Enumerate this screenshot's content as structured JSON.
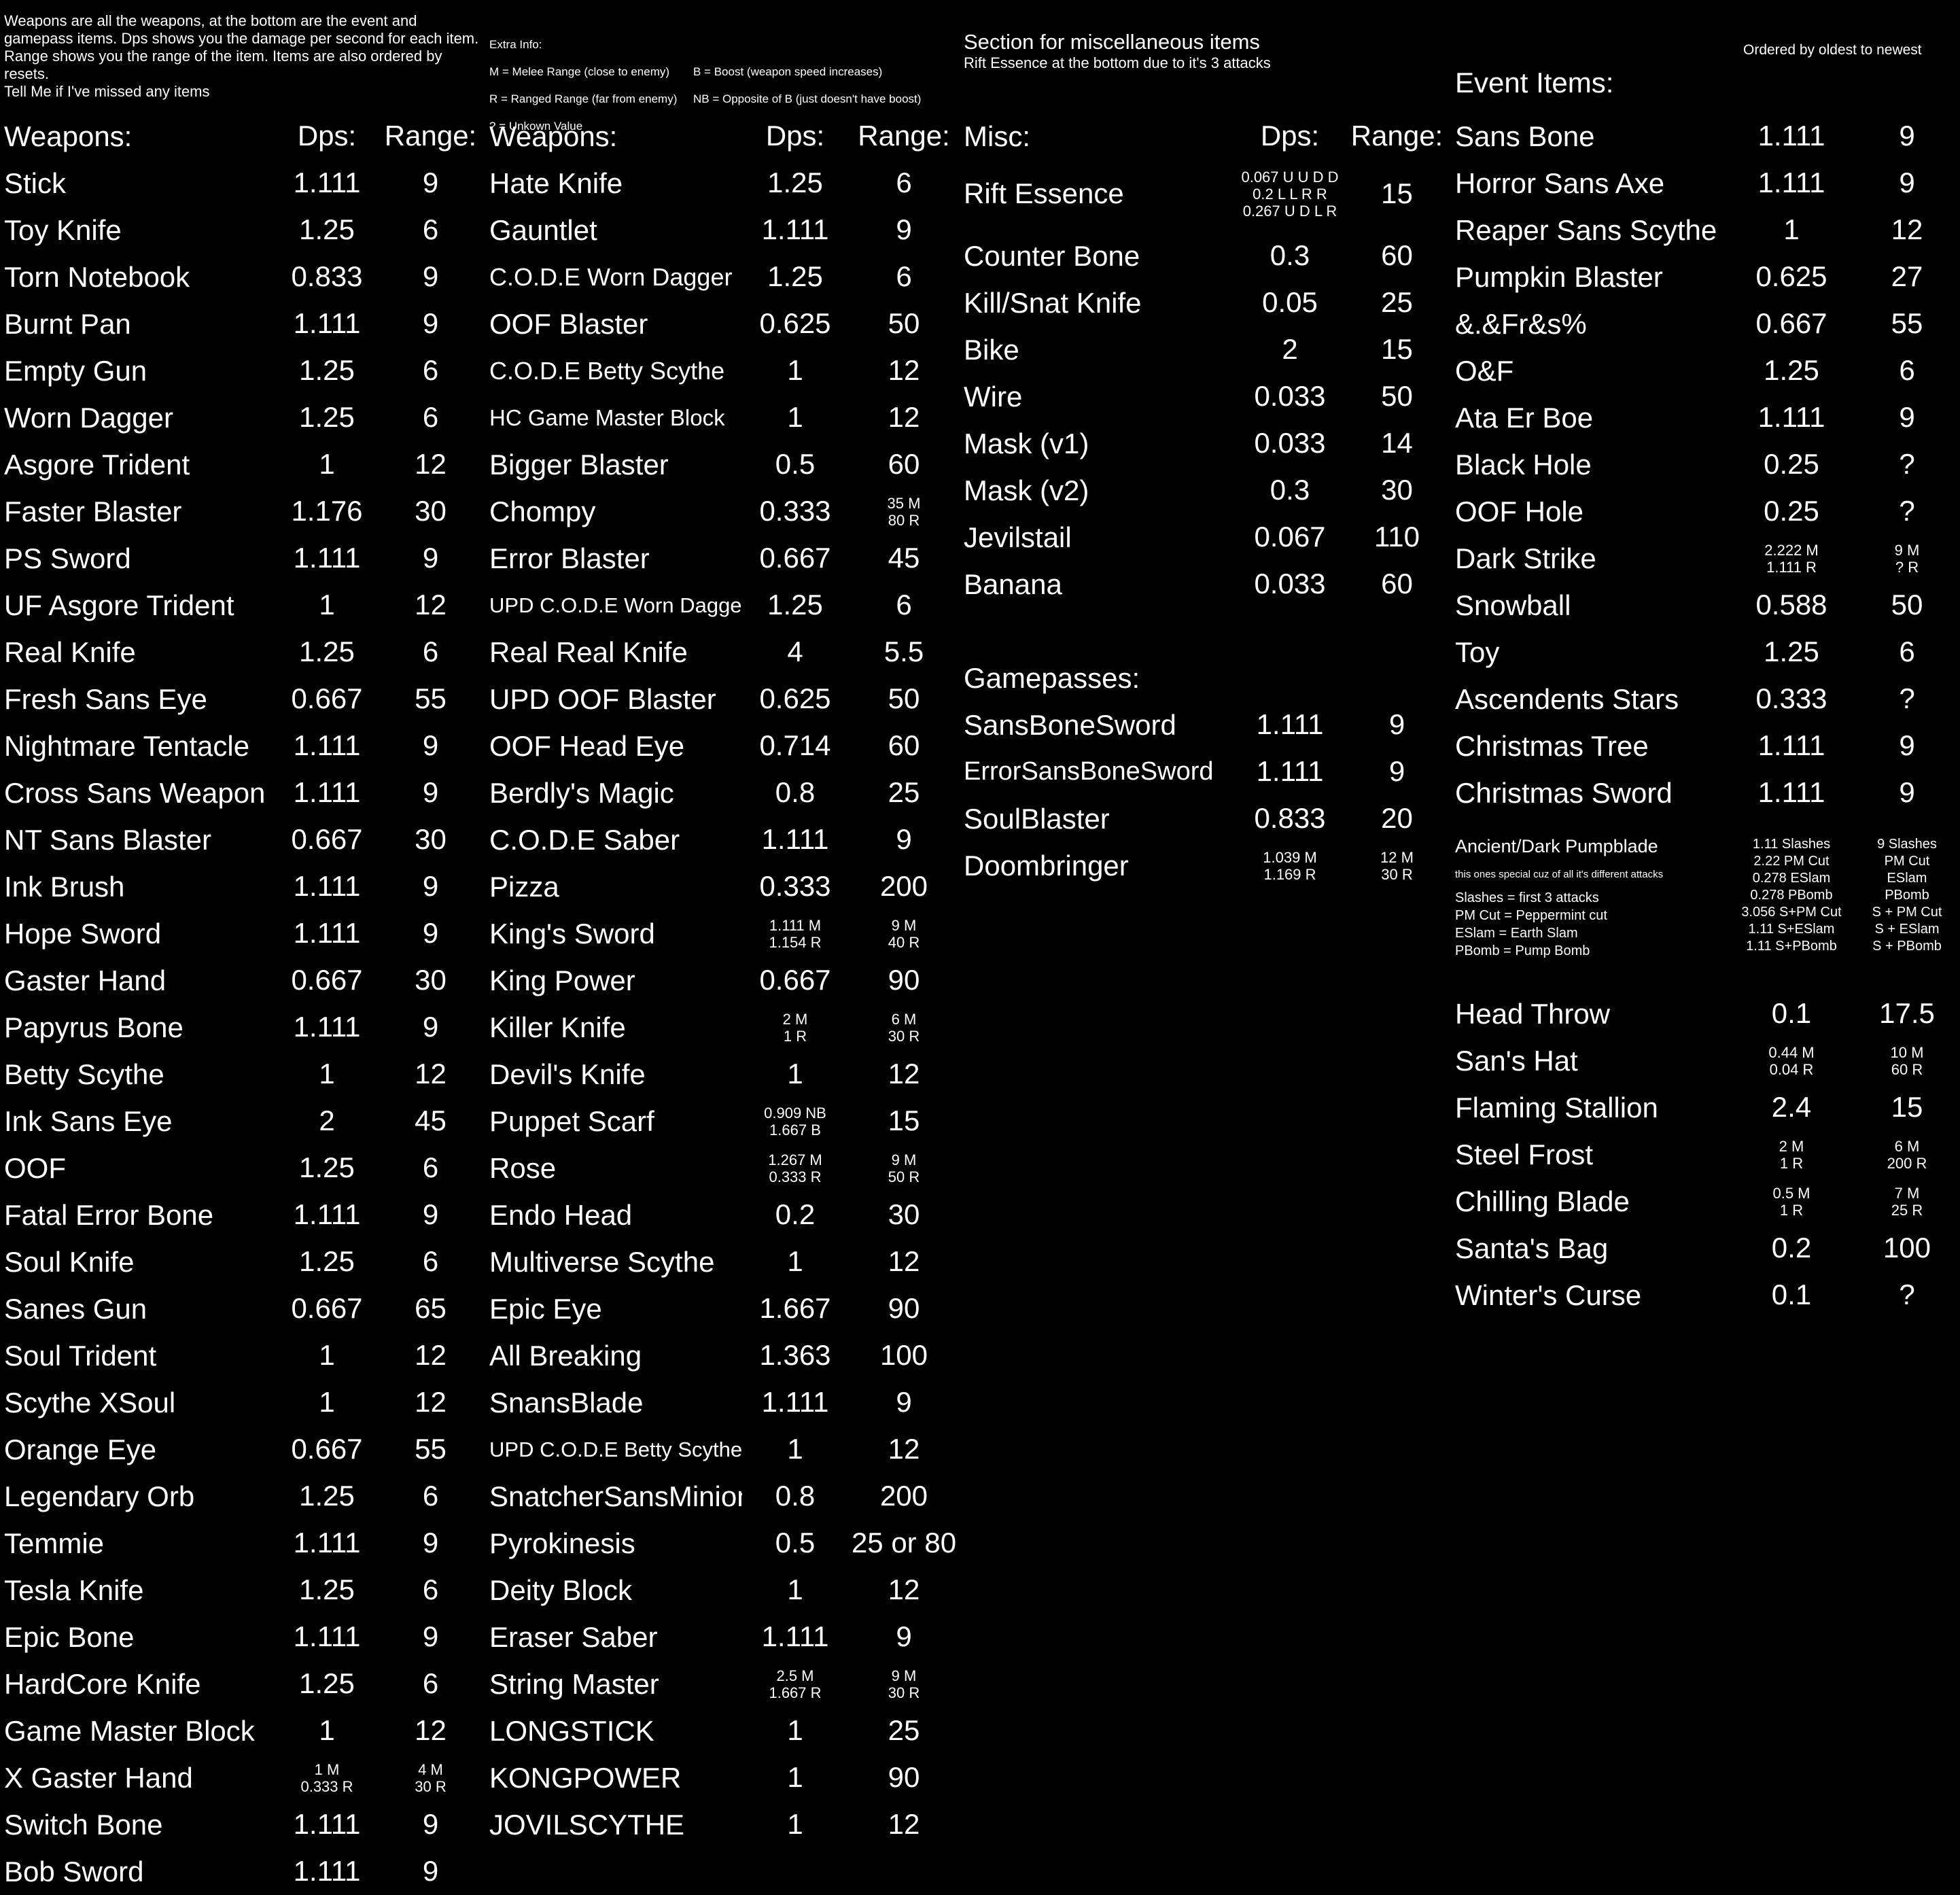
{
  "intro_text": "Weapons are all the weapons, at the bottom are the event and gamepass items. Dps shows you the damage per second for each item. Range shows you the range of the item. Items are also ordered by resets.\nTell Me if I've missed any items",
  "extra_info": {
    "title": "Extra Info:",
    "lines": [
      [
        "M = Melee Range (close to enemy)",
        "B = Boost (weapon speed increases)"
      ],
      [
        "R = Ranged Range (far from enemy)",
        "NB = Opposite of B (just doesn't have boost)"
      ],
      [
        "? = Unkown Value",
        ""
      ]
    ]
  },
  "misc_section": {
    "heading": "Section for miscellaneous items",
    "subheading": "Rift Essence at the bottom due to it's 3 attacks"
  },
  "order_note": "Ordered by oldest to newest",
  "event_heading": "Event Items:",
  "weapons_col1": {
    "header": {
      "name": "Weapons:",
      "dps": "Dps:",
      "range": "Range:"
    },
    "rows": [
      {
        "name": "Stick",
        "dps": "1.111",
        "range": "9"
      },
      {
        "name": "Toy Knife",
        "dps": "1.25",
        "range": "6"
      },
      {
        "name": "Torn Notebook",
        "dps": "0.833",
        "range": "9"
      },
      {
        "name": "Burnt Pan",
        "dps": "1.111",
        "range": "9"
      },
      {
        "name": "Empty Gun",
        "dps": "1.25",
        "range": "6"
      },
      {
        "name": "Worn Dagger",
        "dps": "1.25",
        "range": "6"
      },
      {
        "name": "Asgore Trident",
        "dps": "1",
        "range": "12"
      },
      {
        "name": "Faster Blaster",
        "dps": "1.176",
        "range": "30"
      },
      {
        "name": "PS Sword",
        "dps": "1.111",
        "range": "9"
      },
      {
        "name": "UF Asgore Trident",
        "dps": "1",
        "range": "12"
      },
      {
        "name": "Real Knife",
        "dps": "1.25",
        "range": "6"
      },
      {
        "name": "Fresh Sans Eye",
        "dps": "0.667",
        "range": "55"
      },
      {
        "name": "Nightmare Tentacle",
        "dps": "1.111",
        "range": "9"
      },
      {
        "name": "Cross Sans Weapon",
        "dps": "1.111",
        "range": "9"
      },
      {
        "name": "NT Sans Blaster",
        "dps": "0.667",
        "range": "30"
      },
      {
        "name": "Ink Brush",
        "dps": "1.111",
        "range": "9"
      },
      {
        "name": "Hope Sword",
        "dps": "1.111",
        "range": "9"
      },
      {
        "name": "Gaster Hand",
        "dps": "0.667",
        "range": "30"
      },
      {
        "name": "Papyrus Bone",
        "dps": "1.111",
        "range": "9"
      },
      {
        "name": "Betty Scythe",
        "dps": "1",
        "range": "12"
      },
      {
        "name": "Ink Sans Eye",
        "dps": "2",
        "range": "45"
      },
      {
        "name": "OOF",
        "dps": "1.25",
        "range": "6"
      },
      {
        "name": "Fatal Error Bone",
        "dps": "1.111",
        "range": "9"
      },
      {
        "name": "Soul Knife",
        "dps": "1.25",
        "range": "6"
      },
      {
        "name": "Sanes Gun",
        "dps": "0.667",
        "range": "65"
      },
      {
        "name": "Soul Trident",
        "dps": "1",
        "range": "12"
      },
      {
        "name": "Scythe XSoul",
        "dps": "1",
        "range": "12"
      },
      {
        "name": "Orange Eye",
        "dps": "0.667",
        "range": "55"
      },
      {
        "name": "Legendary Orb",
        "dps": "1.25",
        "range": "6"
      },
      {
        "name": "Temmie",
        "dps": "1.111",
        "range": "9"
      },
      {
        "name": "Tesla Knife",
        "dps": "1.25",
        "range": "6"
      },
      {
        "name": "Epic Bone",
        "dps": "1.111",
        "range": "9"
      },
      {
        "name": "HardCore Knife",
        "dps": "1.25",
        "range": "6"
      },
      {
        "name": "Game Master Block",
        "dps": "1",
        "range": "12"
      },
      {
        "name": "X Gaster Hand",
        "dps": "1 M\n0.333 R",
        "range": "4 M\n30 R"
      },
      {
        "name": "Switch Bone",
        "dps": "1.111",
        "range": "9"
      },
      {
        "name": "Bob Sword",
        "dps": "1.111",
        "range": "9"
      }
    ]
  },
  "weapons_col2": {
    "header": {
      "name": "Weapons:",
      "dps": "Dps:",
      "range": "Range:"
    },
    "rows": [
      {
        "name": "Hate Knife",
        "dps": "1.25",
        "range": "6"
      },
      {
        "name": "Gauntlet",
        "dps": "1.111",
        "range": "9"
      },
      {
        "name": "C.O.D.E Worn Dagger",
        "dps": "1.25",
        "range": "6"
      },
      {
        "name": "OOF Blaster",
        "dps": "0.625",
        "range": "50"
      },
      {
        "name": "C.O.D.E Betty Scythe",
        "dps": "1",
        "range": "12"
      },
      {
        "name": "HC Game Master Block",
        "dps": "1",
        "range": "12"
      },
      {
        "name": "Bigger Blaster",
        "dps": "0.5",
        "range": "60"
      },
      {
        "name": "Chompy",
        "dps": "0.333",
        "range": "35 M\n80 R"
      },
      {
        "name": "Error Blaster",
        "dps": "0.667",
        "range": "45"
      },
      {
        "name": "UPD C.O.D.E Worn Dagger",
        "dps": "1.25",
        "range": "6"
      },
      {
        "name": "Real Real Knife",
        "dps": "4",
        "range": "5.5"
      },
      {
        "name": "UPD OOF Blaster",
        "dps": "0.625",
        "range": "50"
      },
      {
        "name": "OOF Head Eye",
        "dps": "0.714",
        "range": "60"
      },
      {
        "name": "Berdly's Magic",
        "dps": "0.8",
        "range": "25"
      },
      {
        "name": "C.O.D.E Saber",
        "dps": "1.111",
        "range": "9"
      },
      {
        "name": "Pizza",
        "dps": "0.333",
        "range": "200"
      },
      {
        "name": "King's Sword",
        "dps": "1.111 M\n1.154 R",
        "range": "9 M\n40 R"
      },
      {
        "name": "King Power",
        "dps": "0.667",
        "range": "90"
      },
      {
        "name": "Killer Knife",
        "dps": "2 M\n1 R",
        "range": "6 M\n30 R"
      },
      {
        "name": "Devil's Knife",
        "dps": "1",
        "range": "12"
      },
      {
        "name": "Puppet Scarf",
        "dps": "0.909 NB\n1.667 B",
        "range": "15"
      },
      {
        "name": "Rose",
        "dps": "1.267 M\n0.333 R",
        "range": "9 M\n50 R"
      },
      {
        "name": "Endo Head",
        "dps": "0.2",
        "range": "30"
      },
      {
        "name": "Multiverse Scythe",
        "dps": "1",
        "range": "12"
      },
      {
        "name": "Epic Eye",
        "dps": "1.667",
        "range": "90"
      },
      {
        "name": "All Breaking",
        "dps": "1.363",
        "range": "100"
      },
      {
        "name": "SnansBlade",
        "dps": "1.111",
        "range": "9"
      },
      {
        "name": "UPD C.O.D.E Betty Scythe",
        "dps": "1",
        "range": "12"
      },
      {
        "name": "SnatcherSansMinion",
        "dps": "0.8",
        "range": "200"
      },
      {
        "name": "Pyrokinesis",
        "dps": "0.5",
        "range": "25 or 80"
      },
      {
        "name": "Deity Block",
        "dps": "1",
        "range": "12"
      },
      {
        "name": "Eraser Saber",
        "dps": "1.111",
        "range": "9"
      },
      {
        "name": "String Master",
        "dps": "2.5 M\n1.667 R",
        "range": "9 M\n30 R"
      },
      {
        "name": "LONGSTICK",
        "dps": "1",
        "range": "25"
      },
      {
        "name": "KONGPOWER",
        "dps": "1",
        "range": "90"
      },
      {
        "name": "JOVILSCYTHE",
        "dps": "1",
        "range": "12"
      }
    ]
  },
  "misc_col": {
    "header": {
      "name": "Misc:",
      "dps": "Dps:",
      "range": "Range:"
    },
    "rift": {
      "name": "Rift Essence",
      "dps": "0.067 U U D D\n0.2 L L R R\n0.267 U D L R",
      "range": "15"
    },
    "rows": [
      {
        "name": "Counter Bone",
        "dps": "0.3",
        "range": "60"
      },
      {
        "name": "Kill/Snat Knife",
        "dps": "0.05",
        "range": "25"
      },
      {
        "name": "Bike",
        "dps": "2",
        "range": "15"
      },
      {
        "name": "Wire",
        "dps": "0.033",
        "range": "50"
      },
      {
        "name": "Mask (v1)",
        "dps": "0.033",
        "range": "14"
      },
      {
        "name": "Mask (v2)",
        "dps": "0.3",
        "range": "30"
      },
      {
        "name": "Jevilstail",
        "dps": "0.067",
        "range": "110"
      },
      {
        "name": "Banana",
        "dps": "0.033",
        "range": "60"
      }
    ],
    "gamepass_heading": "Gamepasses:",
    "gamepasses": [
      {
        "name": "SansBoneSword",
        "dps": "1.111",
        "range": "9"
      },
      {
        "name": "ErrorSansBoneSword",
        "dps": "1.111",
        "range": "9"
      },
      {
        "name": "SoulBlaster",
        "dps": "0.833",
        "range": "20"
      },
      {
        "name": "Doombringer",
        "dps": "1.039 M\n1.169 R",
        "range": "12 M\n30 R"
      }
    ]
  },
  "event_col": {
    "rows": [
      {
        "name": "Sans Bone",
        "dps": "1.111",
        "range": "9"
      },
      {
        "name": "Horror Sans Axe",
        "dps": "1.111",
        "range": "9"
      },
      {
        "name": "Reaper Sans Scythe",
        "dps": "1",
        "range": "12"
      },
      {
        "name": "Pumpkin Blaster",
        "dps": "0.625",
        "range": "27"
      },
      {
        "name": "&.&Fr&s%",
        "dps": "0.667",
        "range": "55"
      },
      {
        "name": "O&F",
        "dps": "1.25",
        "range": "6"
      },
      {
        "name": "Ata Er Boe",
        "dps": "1.111",
        "range": "9"
      },
      {
        "name": "Black Hole",
        "dps": "0.25",
        "range": "?"
      },
      {
        "name": "OOF Hole",
        "dps": "0.25",
        "range": "?"
      },
      {
        "name": "Dark Strike",
        "dps": "2.222 M\n1.111 R",
        "range": "9 M\n? R"
      },
      {
        "name": "Snowball",
        "dps": "0.588",
        "range": "50"
      },
      {
        "name": "Toy",
        "dps": "1.25",
        "range": "6"
      },
      {
        "name": "Ascendents Stars",
        "dps": "0.333",
        "range": "?"
      },
      {
        "name": "Christmas Tree",
        "dps": "1.111",
        "range": "9"
      },
      {
        "name": "Christmas Sword",
        "dps": "1.111",
        "range": "9"
      }
    ],
    "pumpblade": {
      "name": "Ancient/Dark Pumpblade",
      "note": "this ones special cuz of all it's different attacks",
      "defs": "Slashes = first 3 attacks\nPM Cut = Peppermint cut\nESlam = Earth Slam\nPBomb = Pump Bomb",
      "dps": "1.11 Slashes\n2.22 PM Cut\n0.278 ESlam\n0.278 PBomb\n3.056 S+PM Cut\n1.11 S+ESlam\n1.11 S+PBomb",
      "range": "9 Slashes\nPM Cut\nESlam\nPBomb\nS + PM Cut\nS + ESlam\nS + PBomb"
    },
    "rows2": [
      {
        "name": "Head Throw",
        "dps": "0.1",
        "range": "17.5"
      },
      {
        "name": "San's Hat",
        "dps": "0.44 M\n0.04 R",
        "range": "10 M\n60 R"
      },
      {
        "name": "Flaming Stallion",
        "dps": "2.4",
        "range": "15"
      },
      {
        "name": "Steel Frost",
        "dps": "2 M\n1 R",
        "range": "6 M\n200 R"
      },
      {
        "name": "Chilling Blade",
        "dps": "0.5 M\n1 R",
        "range": "7 M\n25 R"
      },
      {
        "name": "Santa's Bag",
        "dps": "0.2",
        "range": "100"
      },
      {
        "name": "Winter's Curse",
        "dps": "0.1",
        "range": "?"
      }
    ]
  }
}
